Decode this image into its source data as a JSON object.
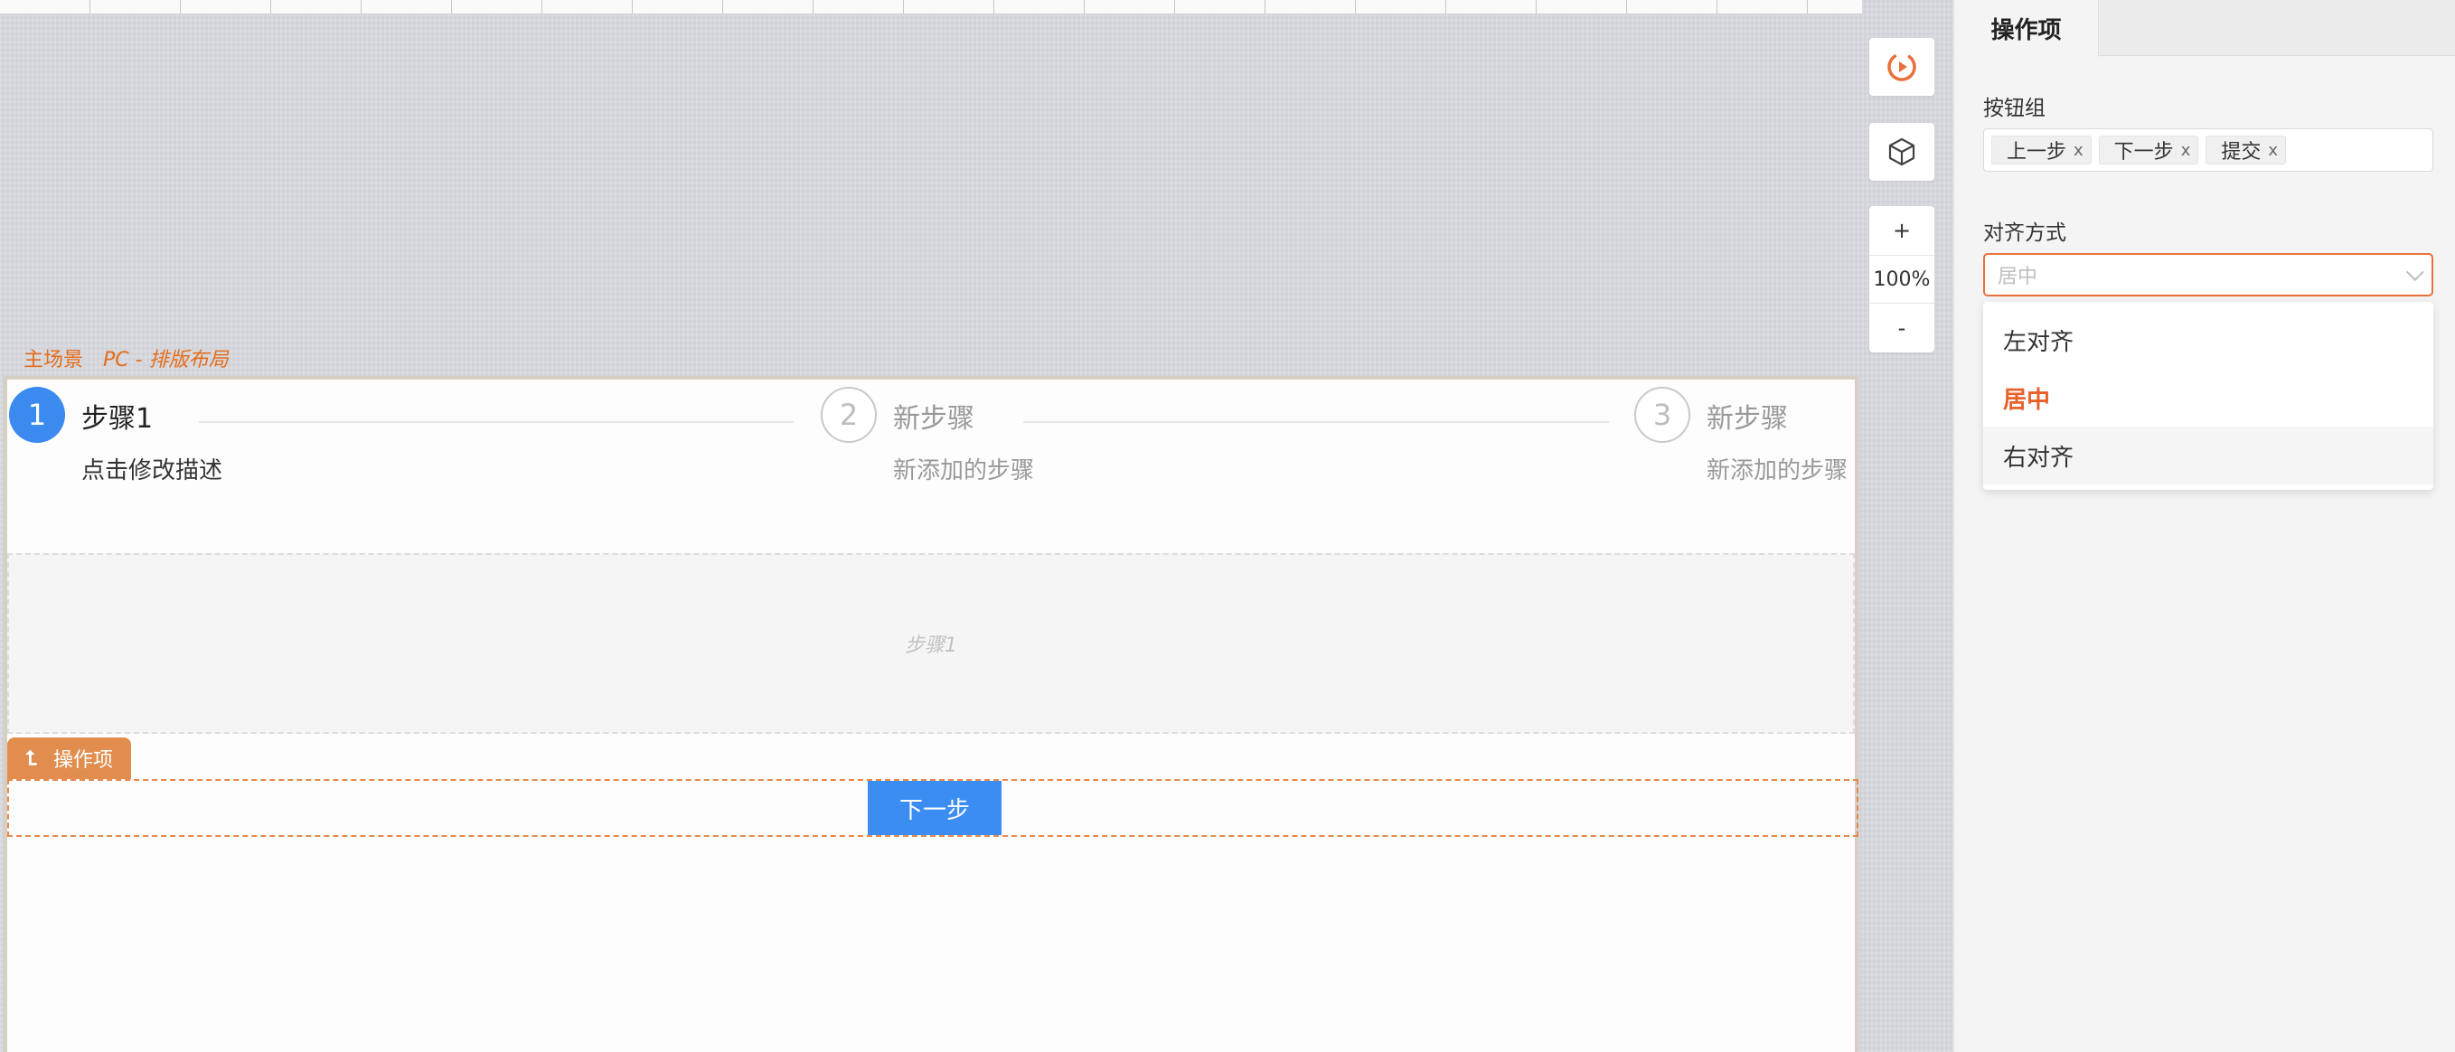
{
  "scene": {
    "label": "主场景",
    "sublabel": "PC - 排版布局"
  },
  "steps": [
    {
      "number": "1",
      "title": "步骤1",
      "description": "点击修改描述",
      "status": "active"
    },
    {
      "number": "2",
      "title": "新步骤",
      "description": "新添加的步骤",
      "status": "wait"
    },
    {
      "number": "3",
      "title": "新步骤",
      "description": "新添加的步骤",
      "status": "wait"
    }
  ],
  "step_content": {
    "placeholder": "步骤1"
  },
  "operations": {
    "tag_label": "操作项",
    "tag_icon": "return-up-icon",
    "next_button": "下一步"
  },
  "toolbar": {
    "preview_icon": "play-circle-icon",
    "component_icon": "cube-icon",
    "zoom_in": "+",
    "zoom_level": "100%",
    "zoom_out": "-"
  },
  "panel": {
    "tab": "操作项",
    "button_group_label": "按钮组",
    "button_group_tags": [
      {
        "label": "上一步",
        "remove": "x"
      },
      {
        "label": "下一步",
        "remove": "x"
      },
      {
        "label": "提交",
        "remove": "x"
      }
    ],
    "align_label": "对齐方式",
    "align_value": "居中",
    "align_options": [
      {
        "label": "左对齐"
      },
      {
        "label": "居中",
        "selected": true
      },
      {
        "label": "右对齐",
        "hovered": true
      }
    ]
  },
  "colors": {
    "accent": "#e8703a",
    "primary": "#3b8af0",
    "ops_tag": "#e18d4e"
  }
}
